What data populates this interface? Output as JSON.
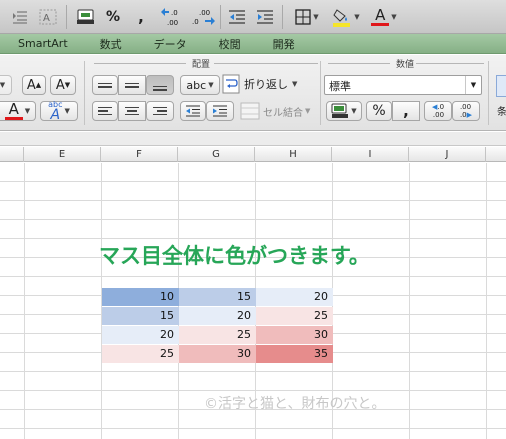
{
  "toolbar": {
    "comma_symbol": "%",
    "comma_style": ",",
    "inc_decimal": ".0→.00",
    "dec_decimal": ".00→.0",
    "font_color_letter": "A"
  },
  "ribbon_tabs": [
    "SmartArt",
    "数式",
    "データ",
    "校閲",
    "開発"
  ],
  "ribbon": {
    "alignment_group_title": "配置",
    "number_group_title": "数値",
    "orientation_label": "abc",
    "wrap_text_label": "折り返し",
    "merge_label": "セル結合",
    "number_format_value": "標準",
    "percent_label": "%",
    "comma_label": ",",
    "inc_decimal_top": ".0",
    "inc_decimal_bottom": ".00",
    "dec_decimal_top": ".00",
    "dec_decimal_bottom": ".0",
    "font_color_letter": "A",
    "phonetic_letter": "abc",
    "phonetic_big": "A",
    "grow_font": "A",
    "shrink_font": "A",
    "cond_format_label": "条"
  },
  "sheet": {
    "columns": [
      "E",
      "F",
      "G",
      "H",
      "I",
      "J"
    ],
    "headline": "マス目全体に色がつきます。",
    "watermark": "©活字と猫と、財布の穴と。",
    "cells": [
      [
        {
          "value": "10",
          "color": "#8eaedc"
        },
        {
          "value": "15",
          "color": "#bccde8"
        },
        {
          "value": "20",
          "color": "#e6edf8"
        }
      ],
      [
        {
          "value": "15",
          "color": "#bccde8"
        },
        {
          "value": "20",
          "color": "#e6edf8"
        },
        {
          "value": "25",
          "color": "#f8e4e4"
        }
      ],
      [
        {
          "value": "20",
          "color": "#e6edf8"
        },
        {
          "value": "25",
          "color": "#f8e4e4"
        },
        {
          "value": "30",
          "color": "#f0bcbc"
        }
      ],
      [
        {
          "value": "25",
          "color": "#f8e4e4"
        },
        {
          "value": "30",
          "color": "#f0bcbc"
        },
        {
          "value": "35",
          "color": "#e68c8c"
        }
      ]
    ]
  },
  "colors": {
    "ribbon_tab_green": "#8fb98f",
    "headline_green": "#27a658",
    "font_color_red": "#e0181b",
    "highlight_yellow": "#f5e52a"
  }
}
